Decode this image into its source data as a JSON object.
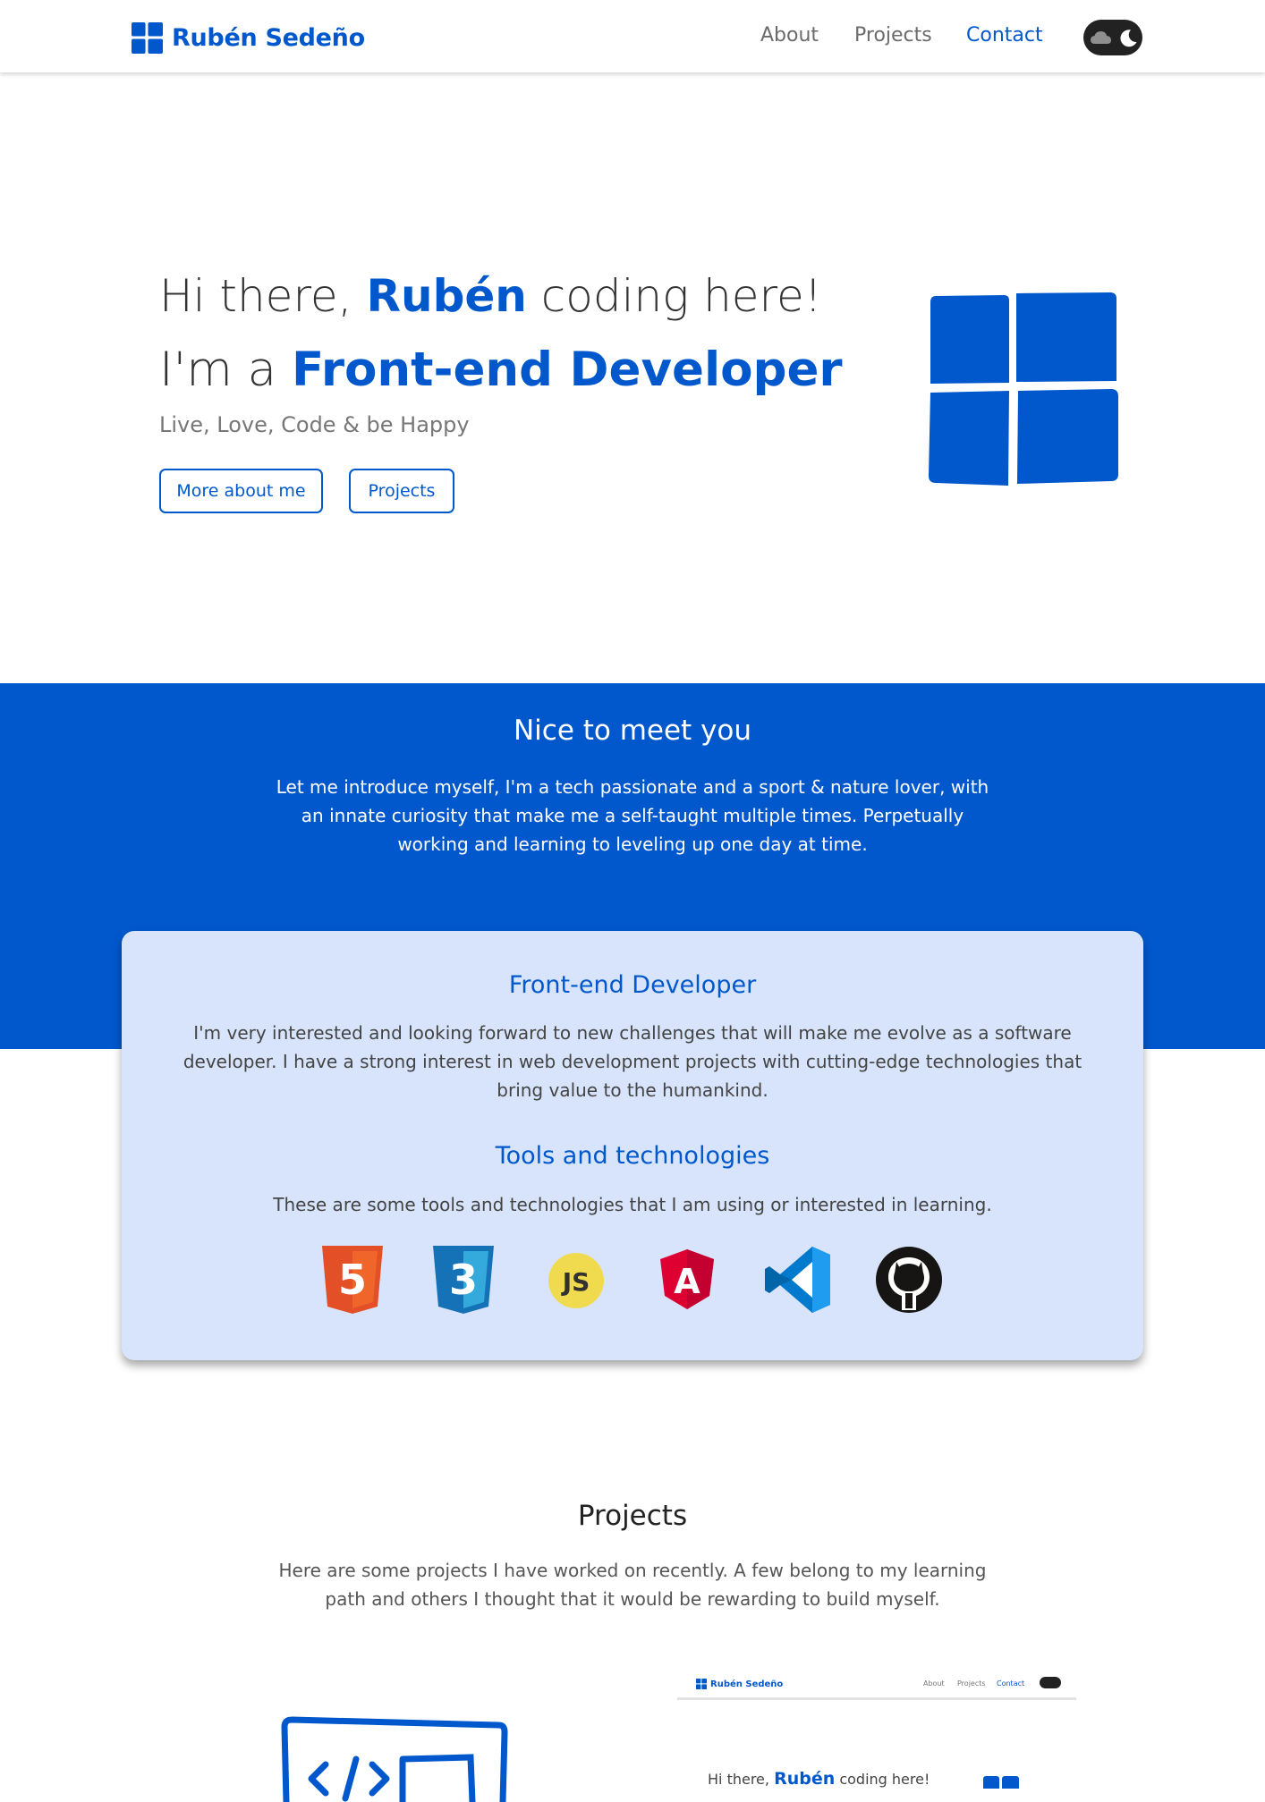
{
  "nav": {
    "brand": "Rubén Sedeño",
    "links": [
      "About",
      "Projects",
      "Contact"
    ],
    "active_link": "Contact",
    "theme_toggle_icons": [
      "cloud-icon",
      "moon-icon"
    ]
  },
  "hero": {
    "greeting_pre": "Hi there,",
    "greeting_name": "Rubén",
    "greeting_post": "coding here!",
    "role_pre": "I'm a",
    "role": "Front-end Developer",
    "tagline": "Live, Love, Code & be Happy",
    "buttons": [
      "More about me",
      "Projects"
    ]
  },
  "about": {
    "title": "Nice to meet you",
    "text": "Let me introduce myself, I'm a tech passionate and a sport & nature lover, with an innate curiosity that make me a self-taught multiple times. Perpetually working and learning to leveling up one day at time."
  },
  "card": {
    "heading1": "Front-end Developer",
    "text1": "I'm very interested and looking forward to new challenges that will make me evolve as a software developer. I have a strong interest in web development projects with cutting-edge technologies that bring value to the humankind.",
    "heading2": "Tools and technologies",
    "text2": "These are some tools and technologies that I am using or interested in learning.",
    "tech_icons": [
      "html5-icon",
      "css3-icon",
      "javascript-icon",
      "angular-icon",
      "vscode-icon",
      "github-icon"
    ],
    "tech_labels": {
      "html5": "5",
      "css3": "3",
      "javascript": "JS",
      "angular": "A"
    }
  },
  "projects": {
    "title": "Projects",
    "text": "Here are some projects I have worked on recently. A few belong to my learning path and others I thought that it would be rewarding to build myself.",
    "preview": {
      "brand": "Rubén Sedeño",
      "links": [
        "About",
        "Projects",
        "Contact"
      ],
      "hero_pre": "Hi there,",
      "hero_name": "Rubén",
      "hero_post": "coding here!"
    }
  },
  "colors": {
    "accent": "#0058cc",
    "card_bg": "#d7e4fb",
    "toggle_bg": "#222222"
  }
}
